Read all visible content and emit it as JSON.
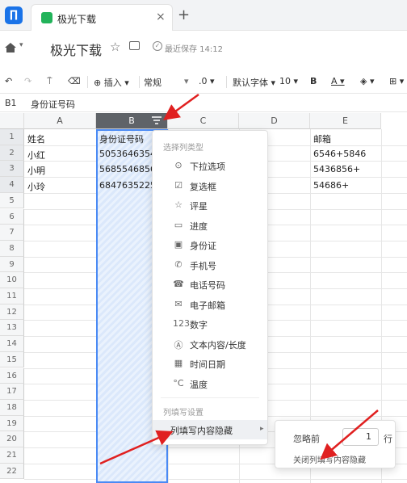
{
  "tab": {
    "title": "极光下载",
    "close": "×",
    "new": "+"
  },
  "titlebar": {
    "doc_title": "极光下载",
    "save_status": "最近保存 14:12"
  },
  "toolbar": {
    "insert": "插入",
    "format": "常规",
    "decimal": ".0",
    "font": "默认字体",
    "size": "10",
    "bold": "B",
    "underline": "A"
  },
  "formula_bar": {
    "cell_ref": "B1",
    "value": "身份证号码"
  },
  "grid": {
    "columns": [
      "A",
      "B",
      "C",
      "D",
      "E"
    ],
    "rows": [
      "1",
      "2",
      "3",
      "4",
      "5",
      "6",
      "7",
      "8",
      "9",
      "10",
      "11",
      "12",
      "13",
      "14",
      "15",
      "16",
      "17",
      "18",
      "19",
      "20",
      "21",
      "22"
    ],
    "cells": {
      "A": [
        "姓名",
        "小红",
        "小明",
        "小玲"
      ],
      "B": [
        "身份证号码",
        "50536463546",
        "56855468564",
        "68476352254"
      ],
      "E": [
        "邮箱",
        "6546+5846",
        "5436856+",
        "54686+"
      ]
    }
  },
  "menu": {
    "section1": "选择列类型",
    "items": [
      {
        "icon": "⊙",
        "label": "下拉选项"
      },
      {
        "icon": "☑",
        "label": "复选框"
      },
      {
        "icon": "☆",
        "label": "评星"
      },
      {
        "icon": "▭",
        "label": "进度"
      },
      {
        "icon": "▣",
        "label": "身份证"
      },
      {
        "icon": "✆",
        "label": "手机号"
      },
      {
        "icon": "☎",
        "label": "电话号码"
      },
      {
        "icon": "✉",
        "label": "电子邮箱"
      },
      {
        "icon": "123",
        "label": "数字"
      },
      {
        "icon": "Ⓐ",
        "label": "文本内容/长度"
      },
      {
        "icon": "▦",
        "label": "时间日期"
      },
      {
        "icon": "°C",
        "label": "温度"
      }
    ],
    "section2": "列填写设置",
    "hide_item": "列填写内容隐藏"
  },
  "subpanel": {
    "ignore_label": "忽略前",
    "rows_value": "1",
    "rows_unit": "行",
    "disable": "关闭列填写内容隐藏"
  },
  "colors": {
    "accent": "#4a8af4",
    "arrow": "#e02020",
    "selected_header": "#5f6368"
  }
}
